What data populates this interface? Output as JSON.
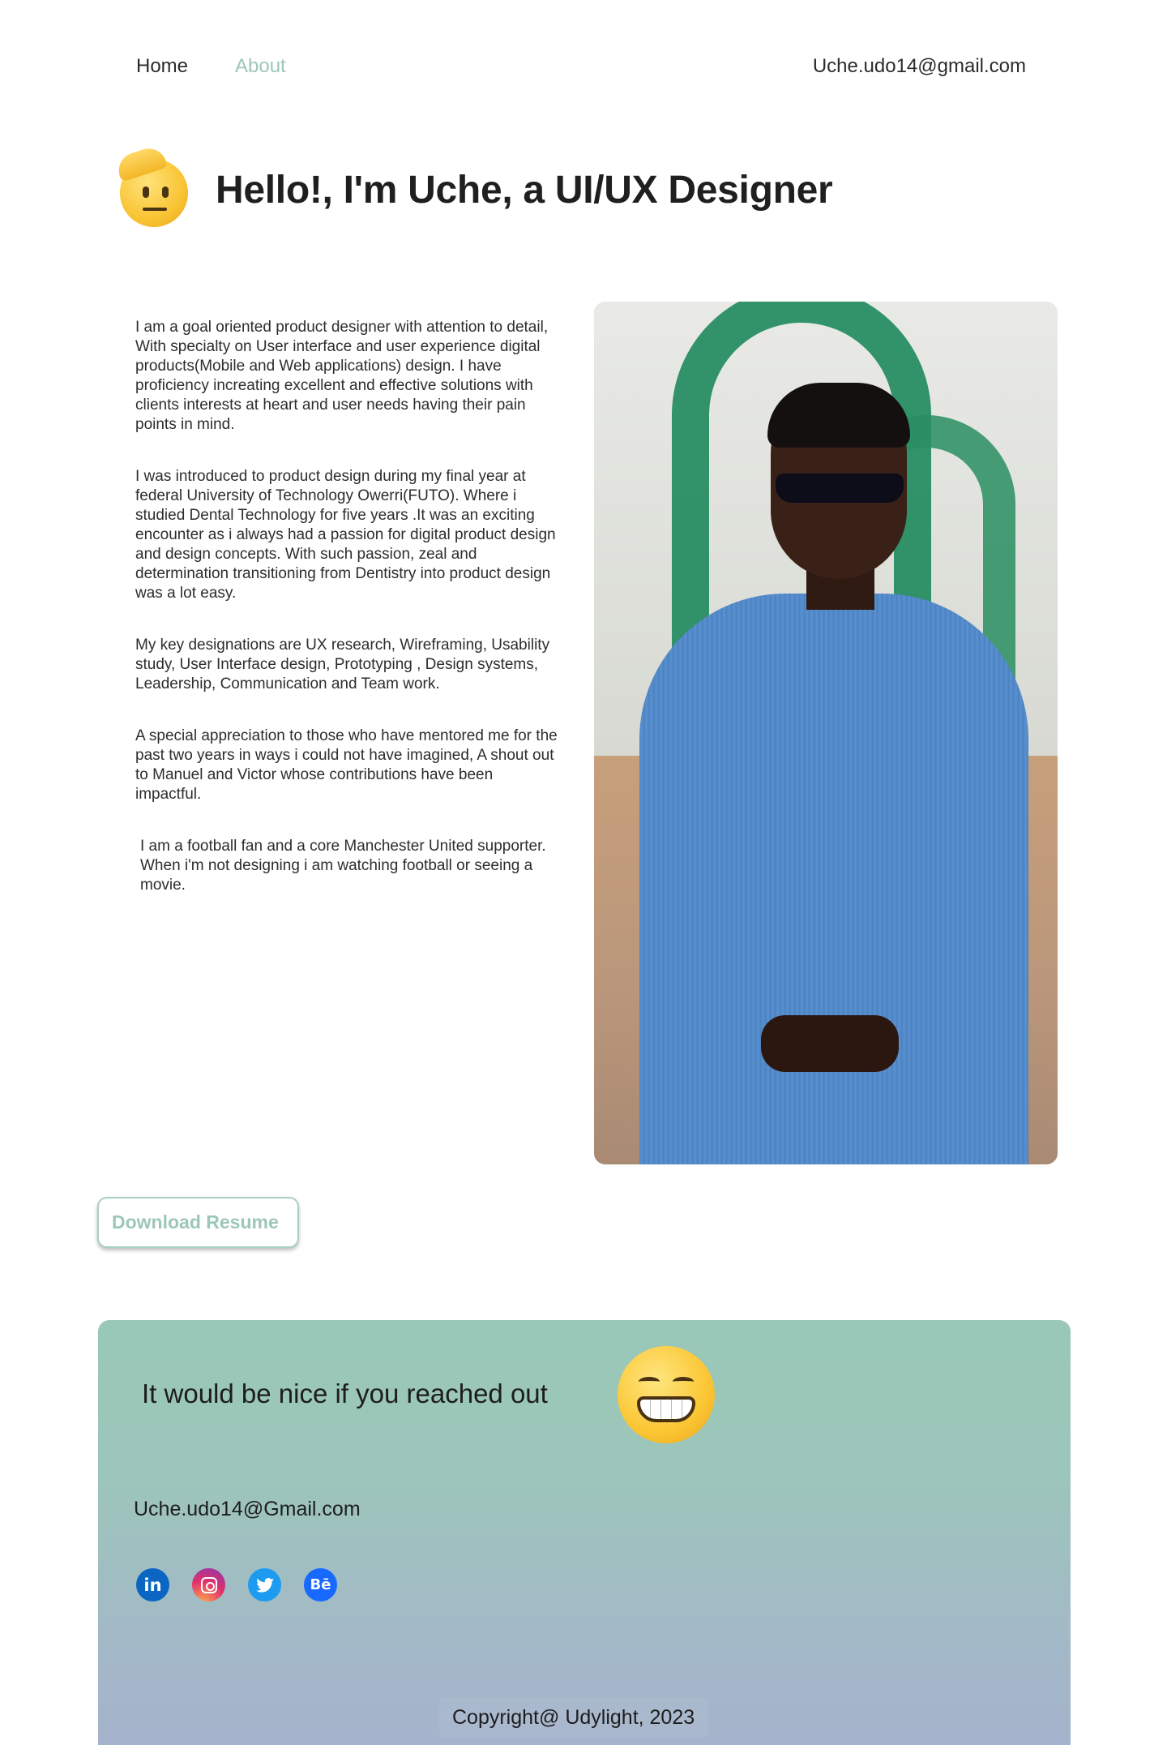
{
  "nav": {
    "home_label": "Home",
    "about_label": "About",
    "email": "Uche.udo14@gmail.com"
  },
  "hero": {
    "emoji": "saluting-face-emoji",
    "title": "Hello!, I'm Uche, a UI/UX Designer"
  },
  "bio": {
    "paragraphs": [
      "I am a goal oriented product designer with attention to detail, With specialty on User interface and user experience digital products(Mobile and Web applications) design. I have proficiency increating excellent and effective solutions with clients interests at heart and user needs having their pain points in mind.",
      "I was introduced to product design during my final year at federal University of Technology Owerri(FUTO). Where i studied Dental Technology for five years .It was an exciting encounter as i always had a passion for digital product design and design concepts. With such passion, zeal and determination transitioning from Dentistry into product design was a lot easy.",
      "My key designations are UX research, Wireframing, Usability study, User Interface design, Prototyping , Design systems, Leadership, Communication and Team work.",
      "A special appreciation to those who have mentored me for the past two years in ways i could not have imagined, A shout out to Manuel and Victor whose contributions have been impactful.",
      "I am a football fan and a core Manchester United supporter. When i'm not designing i am watching football or seeing a movie."
    ]
  },
  "photo": {
    "alt": "portrait-photo"
  },
  "resume": {
    "button_label": "Download Resume"
  },
  "contact": {
    "title": "It would be nice if you reached out",
    "emoji": "grinning-face-emoji",
    "email": "Uche.udo14@Gmail.com",
    "socials": [
      {
        "name": "linkedin-icon",
        "glyph": "in"
      },
      {
        "name": "instagram-icon",
        "glyph": ""
      },
      {
        "name": "twitter-icon",
        "glyph": "🐦"
      },
      {
        "name": "behance-icon",
        "glyph": "Bē"
      }
    ],
    "copyright": "Copyright@ Udylight, 2023"
  },
  "colors": {
    "accent": "#9cc7b8",
    "contact_gradient_top": "#9ac8b8",
    "contact_gradient_bottom": "#a5b3cc",
    "text": "#222222"
  }
}
